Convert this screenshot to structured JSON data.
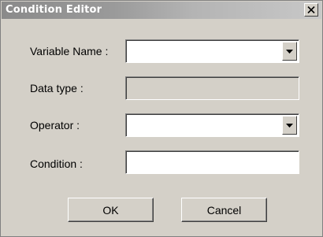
{
  "window": {
    "title": "Condition Editor"
  },
  "form": {
    "variable_name": {
      "label": "Variable Name :",
      "value": ""
    },
    "data_type": {
      "label": "Data type :",
      "value": ""
    },
    "operator": {
      "label": "Operator :",
      "value": ""
    },
    "condition": {
      "label": "Condition :",
      "value": ""
    }
  },
  "buttons": {
    "ok_label": "OK",
    "cancel_label": "Cancel"
  },
  "icons": {
    "close": "close-icon",
    "dropdown": "chevron-down-icon"
  }
}
